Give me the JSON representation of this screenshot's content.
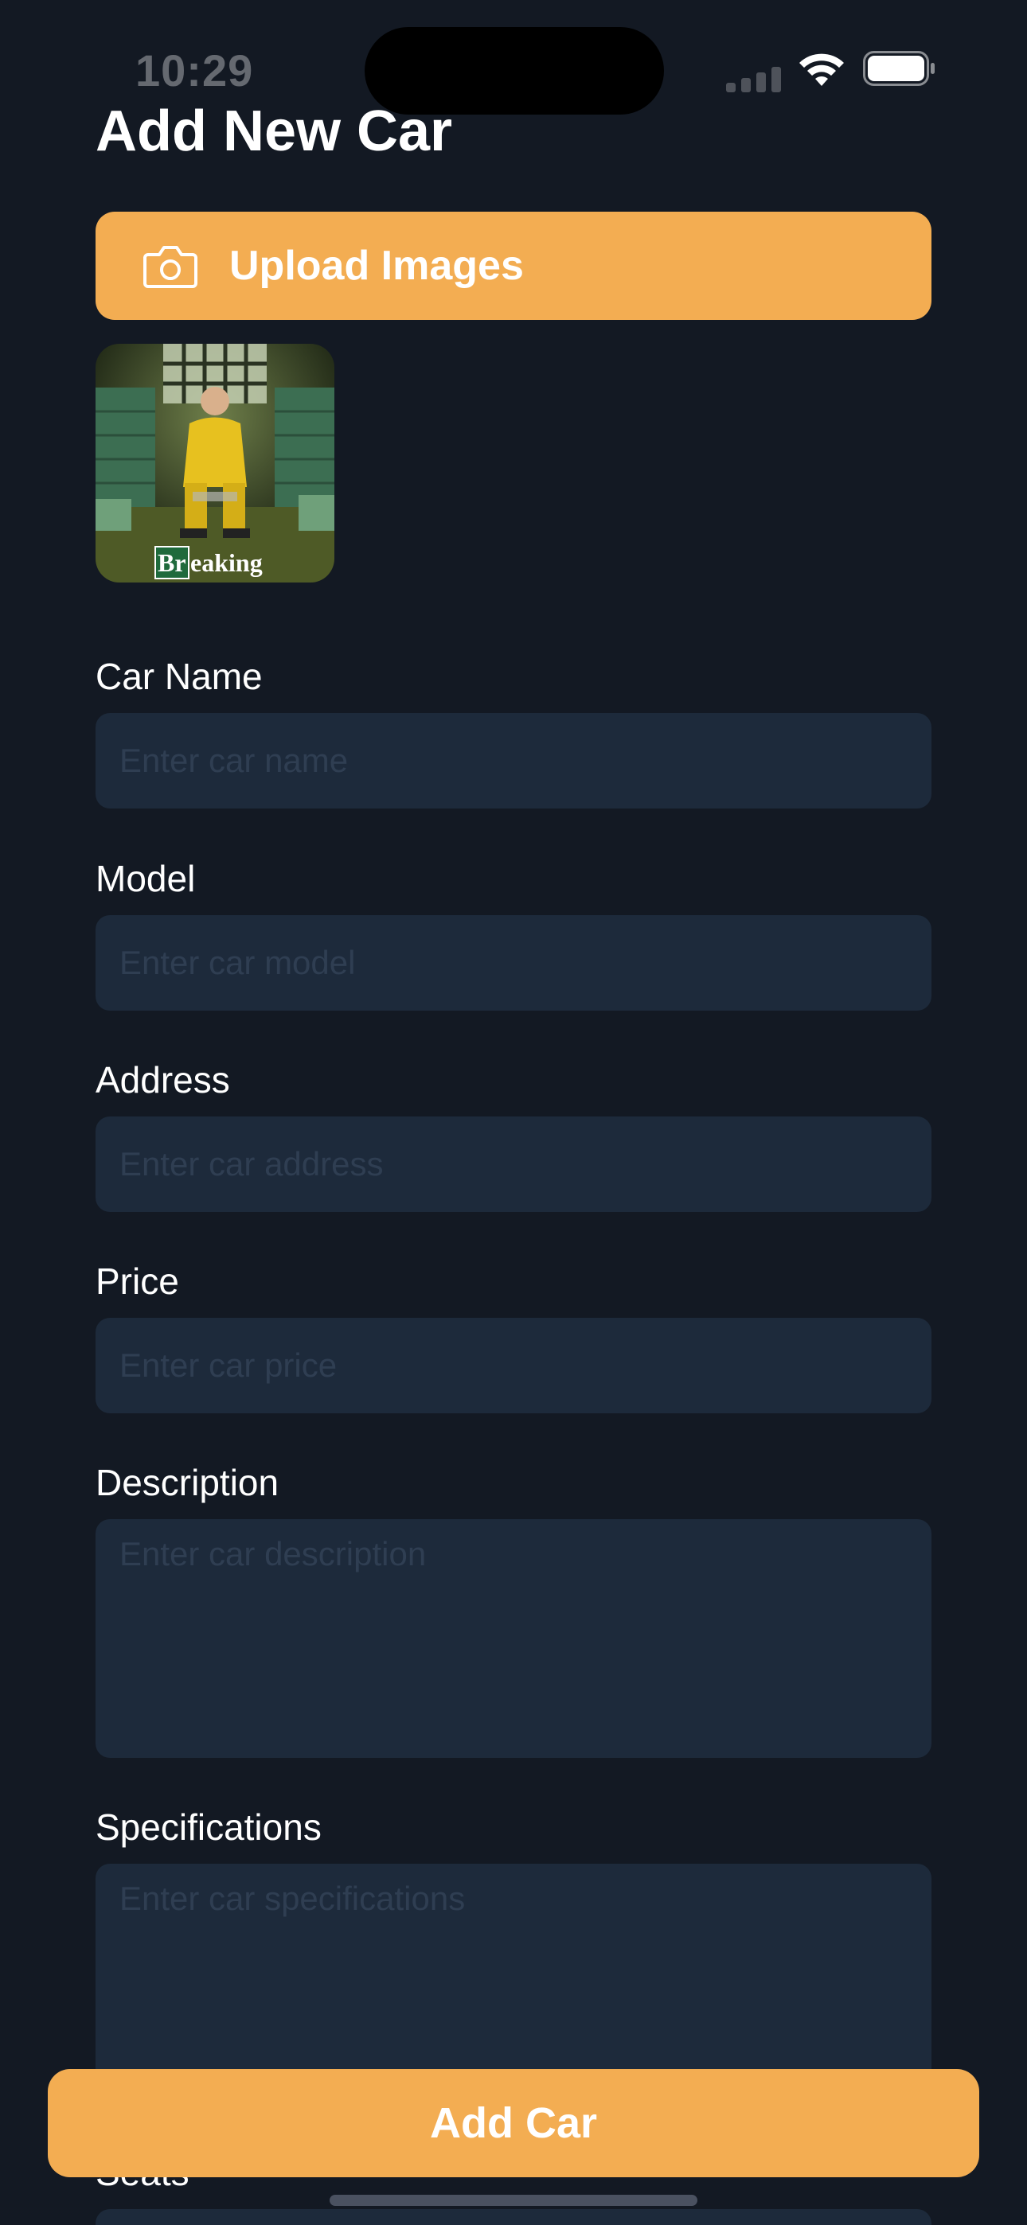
{
  "status_bar": {
    "time": "10:29"
  },
  "page": {
    "title": "Add New Car"
  },
  "upload": {
    "label": "Upload Images",
    "icon": "camera-icon"
  },
  "thumbnail": {
    "caption": "Breaking"
  },
  "fields": {
    "car_name": {
      "label": "Car Name",
      "placeholder": "Enter car name"
    },
    "model": {
      "label": "Model",
      "placeholder": "Enter car model"
    },
    "address": {
      "label": "Address",
      "placeholder": "Enter car address"
    },
    "price": {
      "label": "Price",
      "placeholder": "Enter car price"
    },
    "description": {
      "label": "Description",
      "placeholder": "Enter car description"
    },
    "specifications": {
      "label": "Specifications",
      "placeholder": "Enter car specifications"
    },
    "seats": {
      "label": "Seats"
    }
  },
  "actions": {
    "add_car_label": "Add Car"
  },
  "colors": {
    "background": "#131923",
    "accent": "#f3ad52",
    "field_bg": "#1d2a3b"
  }
}
